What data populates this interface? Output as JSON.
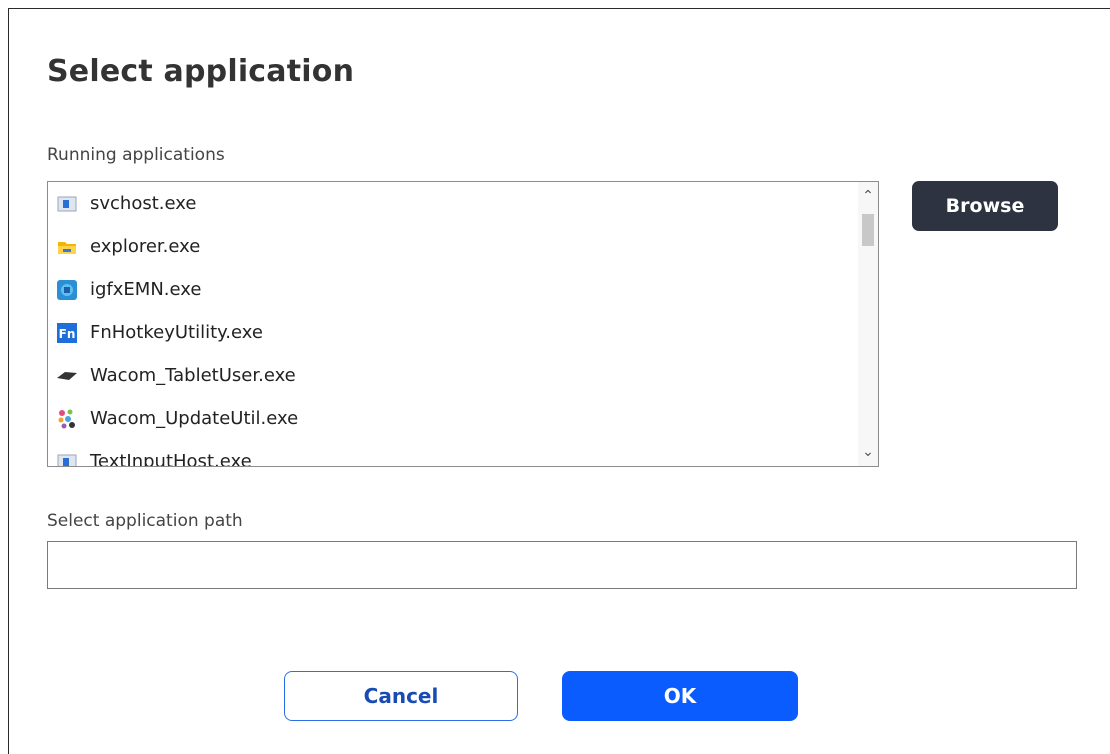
{
  "dialog": {
    "title": "Select application",
    "running_label": "Running applications",
    "path_label": "Select application path",
    "path_value": "",
    "path_placeholder": ""
  },
  "apps": [
    {
      "name": "svchost.exe",
      "icon": "window-app-icon"
    },
    {
      "name": "explorer.exe",
      "icon": "folder-icon"
    },
    {
      "name": "igfxEMN.exe",
      "icon": "intel-graphics-icon"
    },
    {
      "name": "FnHotkeyUtility.exe",
      "icon": "fn-key-icon"
    },
    {
      "name": "Wacom_TabletUser.exe",
      "icon": "tablet-pen-icon"
    },
    {
      "name": "Wacom_UpdateUtil.exe",
      "icon": "wacom-dots-icon"
    },
    {
      "name": "TextInputHost.exe",
      "icon": "window-app-icon"
    }
  ],
  "buttons": {
    "browse": "Browse",
    "cancel": "Cancel",
    "ok": "OK"
  },
  "colors": {
    "browse_bg": "#2d3340",
    "ok_bg": "#0a5cff",
    "cancel_border": "#2a6fe8"
  }
}
